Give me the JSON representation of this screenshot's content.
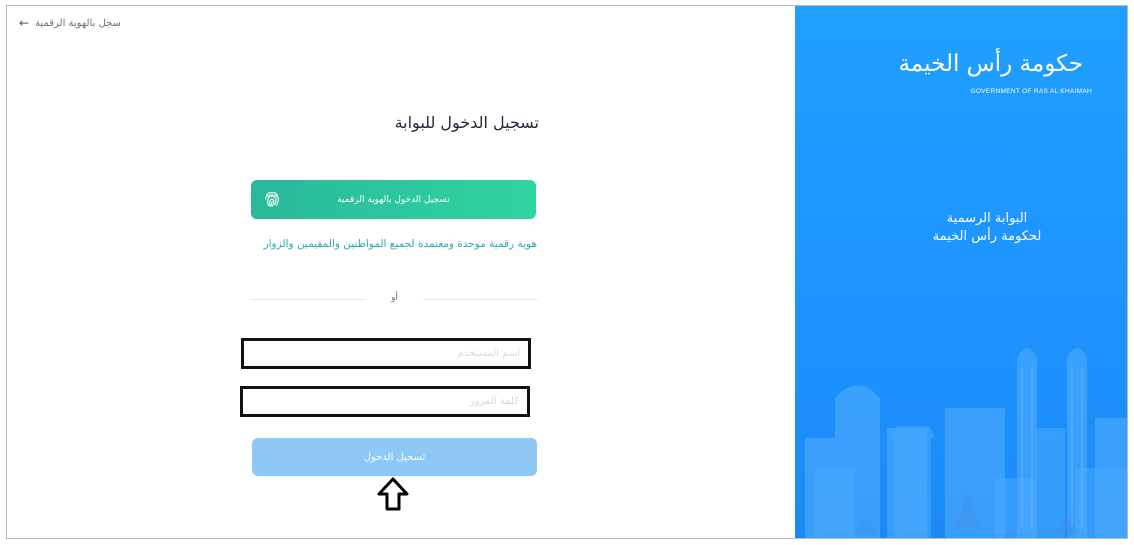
{
  "header": {
    "digital_id_link": "سجل بالهوية الرقمية",
    "back_arrow": "←"
  },
  "login": {
    "title": "تسجيل الدخول للبوابة",
    "digital_id_button": "تسجيل الدخول بالهوية الرقمية",
    "digital_id_description": "هوية رقمية موحدة ومعتمدة لجميع المواطنين والمقيمين والزوار",
    "or_label": "أو",
    "username_placeholder": "اسم المستخدم",
    "password_placeholder": "كلمة المرور",
    "submit_label": "تسجيل الدخول"
  },
  "brand": {
    "name_ar": "حكومة رأس الخيمة",
    "name_en": "GOVERNMENT OF RAS AL KHAIMAH",
    "portal_line1": "البوابة الرسمية",
    "portal_line2": "لحكومة رأس الخيمة"
  },
  "colors": {
    "accent_green": "#2fd5a0",
    "panel_blue": "#1d92ff",
    "submit_blue": "#8dc8f7"
  },
  "icons": {
    "fingerprint": "fingerprint-icon",
    "cursor": "up-arrow-cursor-icon"
  }
}
